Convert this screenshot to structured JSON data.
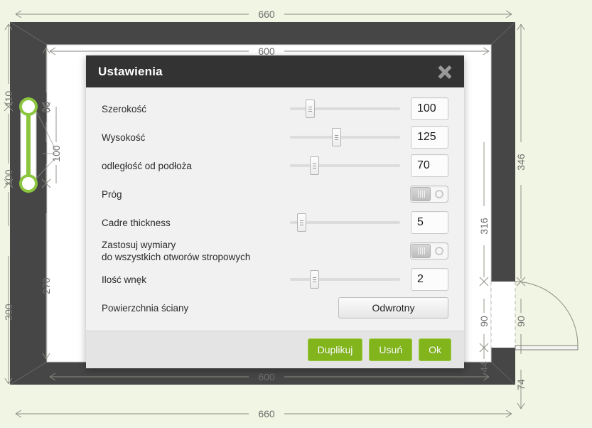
{
  "plan": {
    "background_color": "#f1f5e3",
    "wall_color": "#464646",
    "interior_color": "#ffffff",
    "selection_color": "#8cc63e",
    "dimension_color": "#6e6e6e",
    "dimensions": {
      "top_outer": "660",
      "top_inner": "600",
      "bottom_inner": "600",
      "bottom_outer": "660",
      "left_outer_upper": "110",
      "left_outer_middle": "100",
      "left_outer_lower": "300",
      "left_inner_upper": "80",
      "left_inner_window": "100",
      "left_inner_lower": "270",
      "right_inner_upper": "316",
      "right_inner_lower": "90",
      "right_outer_upper": "346",
      "right_outer_door": "90",
      "right_outer_lower": "74",
      "right_inner_bottom": "44"
    }
  },
  "dialog": {
    "title": "Ustawienia",
    "close_icon": "close-icon",
    "rows": [
      {
        "label": "Szerokość",
        "type": "slider",
        "value": "100",
        "fill": 18
      },
      {
        "label": "Wysokość",
        "type": "slider",
        "value": "125",
        "fill": 42
      },
      {
        "label": "odległość od podłoża",
        "type": "slider",
        "value": "70",
        "fill": 22
      },
      {
        "label": "Próg",
        "type": "toggle",
        "value": "off"
      },
      {
        "label": "Cadre thickness",
        "type": "slider",
        "value": "5",
        "fill": 10
      },
      {
        "label": "Zastosuj wymiary\ndo wszystkich otworów stropowych",
        "type": "toggle",
        "value": "off"
      },
      {
        "label": "Ilość wnęk",
        "type": "slider",
        "value": "2",
        "fill": 22
      },
      {
        "label": "Powierzchnia ściany",
        "type": "button",
        "value": "Odwrotny"
      }
    ],
    "footer": {
      "duplicate_label": "Duplikuj",
      "delete_label": "Usuń",
      "ok_label": "Ok",
      "accent_color": "#82b51b"
    }
  }
}
